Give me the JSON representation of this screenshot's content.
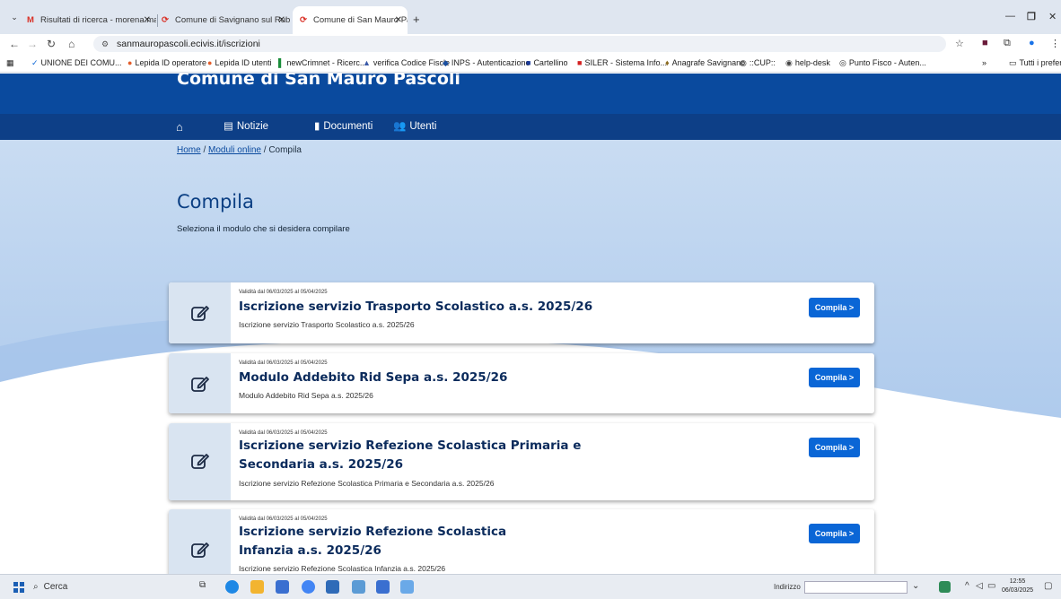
{
  "browser": {
    "tabs": [
      {
        "label": "Risultati di ricerca - morena.ma",
        "icon": "gmail-icon",
        "active": false
      },
      {
        "label": "Comune di Savignano sul Rubic",
        "icon": "site-icon",
        "active": false
      },
      {
        "label": "Comune di San Mauro Pascoli",
        "icon": "site-icon",
        "active": true
      }
    ],
    "new_tab": "+",
    "url": "sanmauropascoli.ecivis.it/iscrizioni",
    "bookmarks": [
      {
        "label": "UNIONE DEI COMU..."
      },
      {
        "label": "Lepida ID operatore"
      },
      {
        "label": "Lepida ID utenti"
      },
      {
        "label": "newCrimnet - Ricerc..."
      },
      {
        "label": "verifica Codice Fiscle"
      },
      {
        "label": "INPS - Autenticazione"
      },
      {
        "label": "Cartellino"
      },
      {
        "label": "SILER - Sistema Info..."
      },
      {
        "label": "Anagrafe Savignano"
      },
      {
        "label": "::CUP::"
      },
      {
        "label": "help-desk"
      },
      {
        "label": "Punto Fisco - Auten..."
      }
    ],
    "bookmarks_overflow": "»",
    "all_bookmarks": "Tutti i preferiti"
  },
  "site": {
    "title": "Comune di San Mauro Pascoli",
    "nav": [
      {
        "label": "",
        "icon": "home-icon"
      },
      {
        "label": "Notizie",
        "icon": "newspaper-icon"
      },
      {
        "label": "Documenti",
        "icon": "document-icon"
      },
      {
        "label": "Utenti",
        "icon": "users-icon"
      }
    ],
    "breadcrumb": {
      "home": "Home",
      "sep": "/",
      "modules": "Moduli online",
      "current": "Compila"
    },
    "page_title": "Compila",
    "page_subtitle": "Seleziona il modulo che si desidera compilare",
    "forms": [
      {
        "validity": "Validità dal 06/03/2025 al 05/04/2025",
        "title": "Iscrizione servizio Trasporto Scolastico a.s. 2025/26",
        "description": "Iscrizione servizio Trasporto Scolastico a.s. 2025/26",
        "button": "Compila >"
      },
      {
        "validity": "Validità dal 06/03/2025 al 05/04/2025",
        "title": "Modulo Addebito Rid Sepa a.s. 2025/26",
        "description": "Modulo Addebito Rid Sepa a.s. 2025/26",
        "button": "Compila >"
      },
      {
        "validity": "Validità dal 06/03/2025 al 05/04/2025",
        "title": "Iscrizione servizio Refezione Scolastica Primaria e Secondaria a.s. 2025/26",
        "description": "Iscrizione servizio Refezione Scolastica Primaria e Secondaria a.s. 2025/26",
        "button": "Compila >"
      },
      {
        "validity": "Validità dal 06/03/2025 al 05/04/2025",
        "title": "Iscrizione servizio Refezione Scolastica Infanzia a.s. 2025/26",
        "description": "Iscrizione servizio Refezione Scolastica Infanzia a.s. 2025/26",
        "button": "Compila >"
      }
    ]
  },
  "taskbar": {
    "search_placeholder": "Cerca",
    "address_label": "Indirizzo",
    "time": "12:55",
    "date": "06/03/2025"
  },
  "colors": {
    "header": "#0a4a9e",
    "nav": "#0d3f87",
    "button": "#0a66d6",
    "title": "#0b3f83"
  }
}
